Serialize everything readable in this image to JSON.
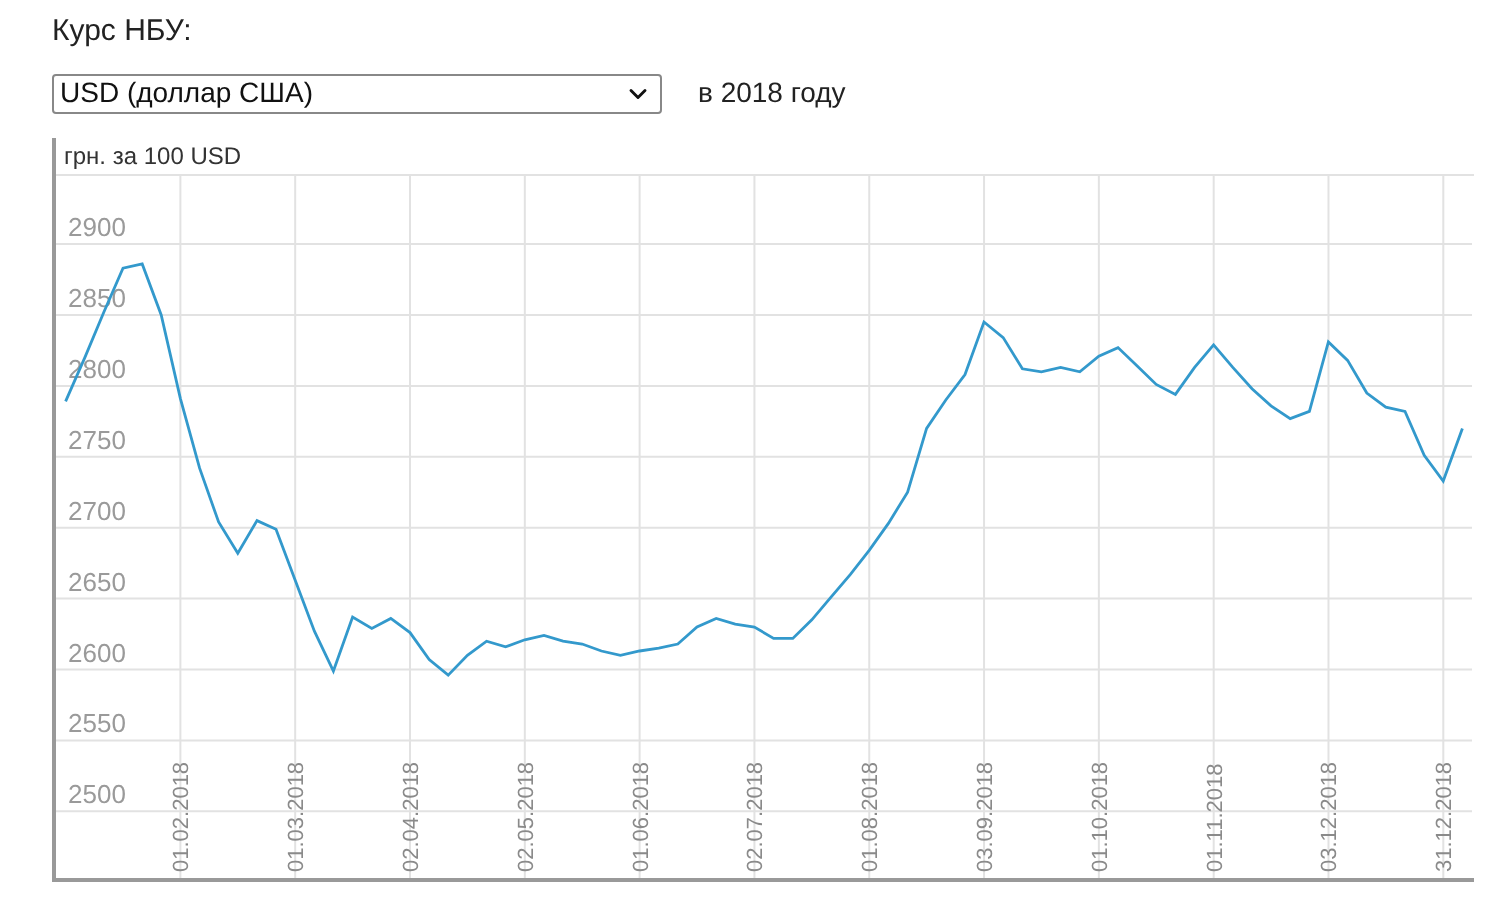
{
  "title": "Курс НБУ:",
  "currency_select": {
    "value": "USD (доллар США)"
  },
  "year_label": "в 2018 году",
  "chart": {
    "unit_label": "грн. за 100 USD",
    "chart_data": {
      "type": "line",
      "categories": [
        null,
        null,
        null,
        null,
        null,
        null,
        "01.02.2018",
        null,
        null,
        null,
        null,
        null,
        "01.03.2018",
        null,
        null,
        null,
        null,
        null,
        "02.04.2018",
        null,
        null,
        null,
        null,
        null,
        "02.05.2018",
        null,
        null,
        null,
        null,
        null,
        "01.06.2018",
        null,
        null,
        null,
        null,
        null,
        "02.07.2018",
        null,
        null,
        null,
        null,
        null,
        "01.08.2018",
        null,
        null,
        null,
        null,
        null,
        "03.09.2018",
        null,
        null,
        null,
        null,
        null,
        "01.10.2018",
        null,
        null,
        null,
        null,
        null,
        "01.11.2018",
        null,
        null,
        null,
        null,
        null,
        "03.12.2018",
        null,
        null,
        null,
        null,
        null,
        "31.12.2018",
        null
      ],
      "series": [
        {
          "color": "#3399cc",
          "values": [
            2789,
            2820,
            2852,
            2883,
            2886,
            2850,
            2791,
            2742,
            2704,
            2682,
            2705,
            2699,
            2663,
            2627,
            2599,
            2637,
            2629,
            2636,
            2626,
            2607,
            2596,
            2610,
            2620,
            2616,
            2621,
            2624,
            2620,
            2618,
            2613,
            2610,
            2613,
            2615,
            2618,
            2630,
            2636,
            2632,
            2630,
            2622,
            2622,
            2635,
            2651,
            2667,
            2684,
            2703,
            2725,
            2770,
            2790,
            2808,
            2845,
            2834,
            2812,
            2810,
            2813,
            2810,
            2821,
            2827,
            2814,
            2801,
            2794,
            2813,
            2829,
            2813,
            2798,
            2786,
            2777,
            2782,
            2831,
            2818,
            2795,
            2785,
            2782,
            2751,
            2733,
            2770
          ]
        }
      ],
      "grid": true,
      "ylim": [
        2453,
        2948
      ],
      "yticks": [
        2500,
        2550,
        2600,
        2650,
        2700,
        2750,
        2800,
        2850,
        2900
      ]
    }
  }
}
